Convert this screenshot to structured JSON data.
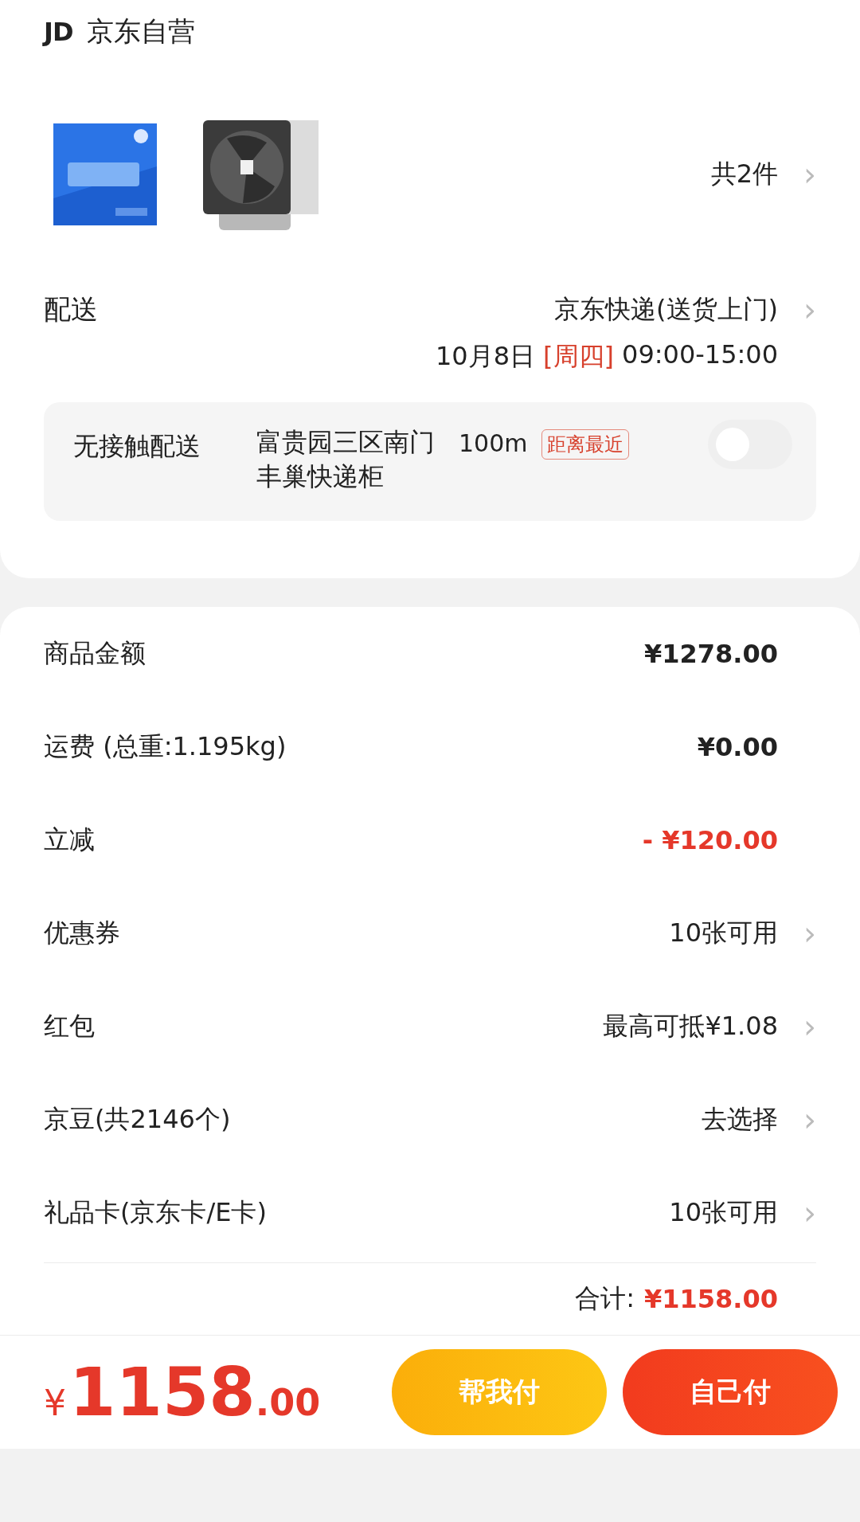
{
  "store": {
    "logo": "JD",
    "name": "京东自营"
  },
  "products": {
    "count": "共2件",
    "chevron": "›"
  },
  "delivery": {
    "label": "配送",
    "method": "京东快递(送货上门)",
    "chevron": "›",
    "date": "10月8日",
    "weekday": "[周四]",
    "time": "09:00-15:00"
  },
  "contactless": {
    "label": "无接触配送",
    "locker": "富贵园三区南门丰巢快递柜",
    "distance": "100m",
    "tag": "距离最近",
    "on": false
  },
  "summary": [
    {
      "label": "商品金额",
      "value": "¥1278.00",
      "kind": "amount"
    },
    {
      "label": "运费 (总重:1.195kg)",
      "value": "¥0.00",
      "kind": "amount"
    },
    {
      "label": "立减",
      "value": "- ¥120.00",
      "kind": "discount"
    },
    {
      "label": "优惠券",
      "value": "10张可用",
      "kind": "option",
      "chevron": "›"
    },
    {
      "label": "红包",
      "value": "最高可抵¥1.08",
      "kind": "option",
      "chevron": "›"
    },
    {
      "label": "京豆(共2146个)",
      "value": "去选择",
      "kind": "link",
      "chevron": "›"
    },
    {
      "label": "礼品卡(京东卡/E卡)",
      "value": "10张可用",
      "kind": "option",
      "chevron": "›"
    }
  ],
  "total": {
    "label": "合计:",
    "value": "¥1158.00"
  },
  "bottom_bar": {
    "currency": "¥",
    "integer": "1158",
    "decimal": ".00",
    "buttons": [
      {
        "label": "帮我付",
        "kind": "secondary"
      },
      {
        "label": "自己付",
        "kind": "primary"
      }
    ]
  }
}
